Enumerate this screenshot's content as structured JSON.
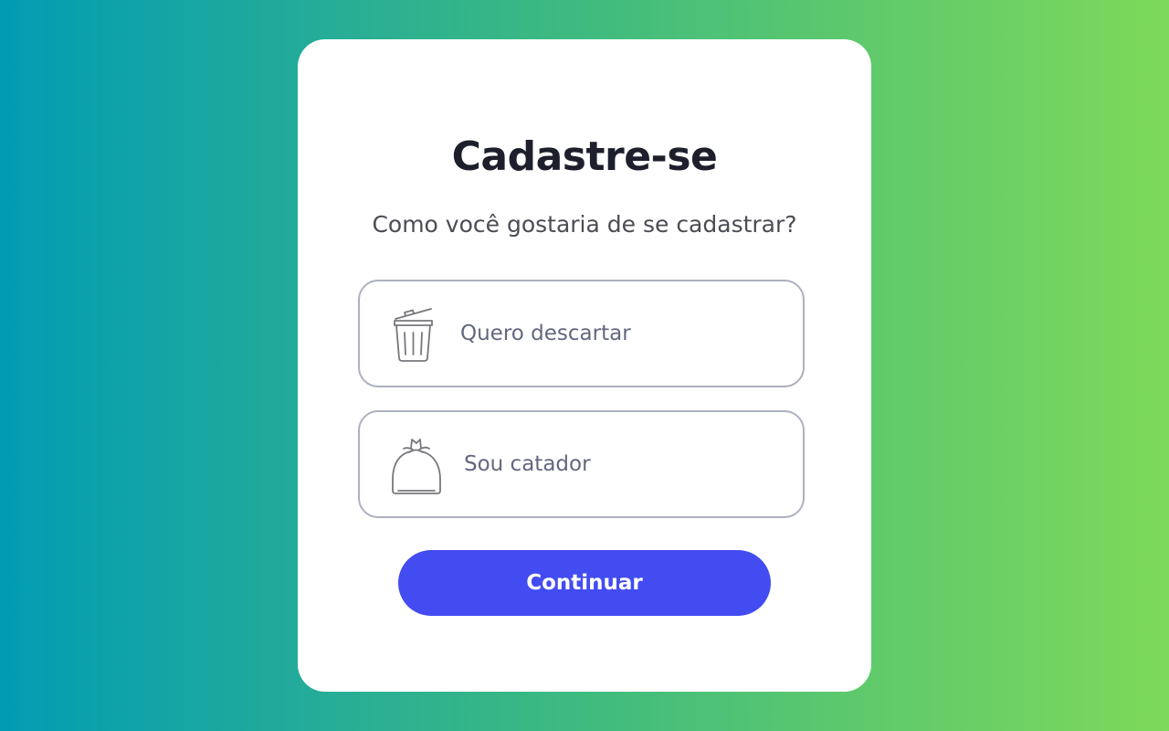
{
  "form": {
    "title": "Cadastre-se",
    "subtitle": "Como você gostaria de se cadastrar?",
    "options": [
      {
        "label": "Quero descartar",
        "icon": "trash-can-icon"
      },
      {
        "label": "Sou catador",
        "icon": "garbage-bag-icon"
      }
    ],
    "continue_label": "Continuar"
  },
  "colors": {
    "background_gradient_start": "#019cb3",
    "background_gradient_end": "#7dd95a",
    "card": "#ffffff",
    "title": "#1e1f2c",
    "subtitle": "#4b4c54",
    "option_border": "#adb0c0",
    "option_text": "#63677f",
    "primary_button": "#424cf1"
  }
}
